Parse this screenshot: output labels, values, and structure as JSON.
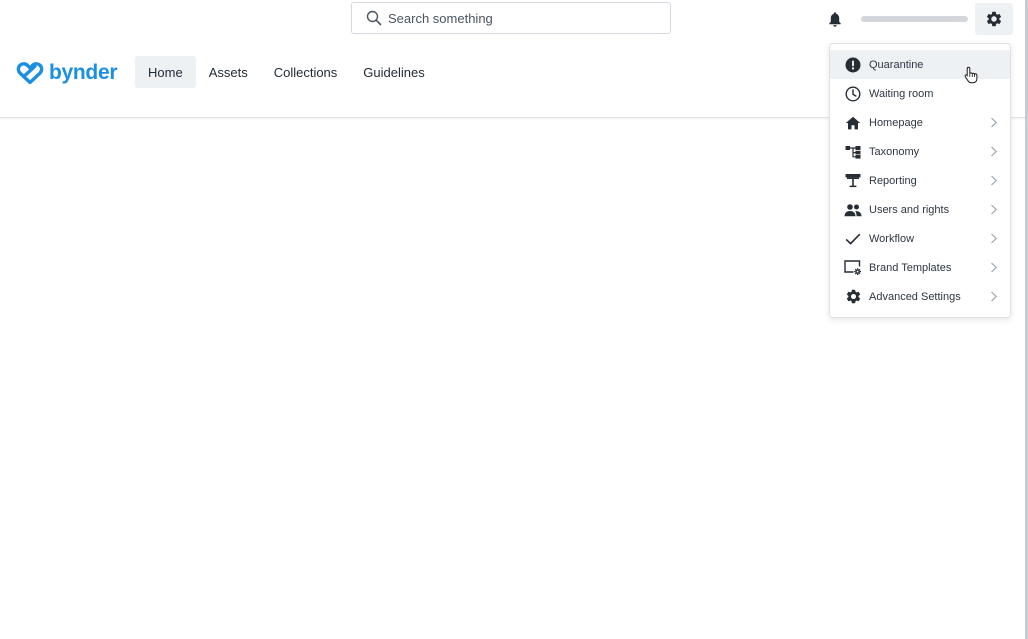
{
  "header": {
    "search": {
      "placeholder": "Search something",
      "icon": "search-icon"
    },
    "notifications_icon": "bell-icon",
    "settings_icon": "gear-icon"
  },
  "brand": {
    "name": "bynder",
    "color": "#1a8fe3"
  },
  "nav": {
    "items": [
      {
        "label": "Home",
        "active": true
      },
      {
        "label": "Assets",
        "active": false
      },
      {
        "label": "Collections",
        "active": false
      },
      {
        "label": "Guidelines",
        "active": false
      }
    ]
  },
  "settings_menu": {
    "items": [
      {
        "label": "Quarantine",
        "icon": "alert-circle-icon",
        "submenu": false,
        "hovered": true
      },
      {
        "label": "Waiting room",
        "icon": "clock-icon",
        "submenu": false
      },
      {
        "label": "Homepage",
        "icon": "home-icon",
        "submenu": true
      },
      {
        "label": "Taxonomy",
        "icon": "taxonomy-icon",
        "submenu": true
      },
      {
        "label": "Reporting",
        "icon": "presentation-icon",
        "submenu": true
      },
      {
        "label": "Users and rights",
        "icon": "users-icon",
        "submenu": true
      },
      {
        "label": "Workflow",
        "icon": "check-icon",
        "submenu": true
      },
      {
        "label": "Brand Templates",
        "icon": "brand-templates-icon",
        "submenu": true
      },
      {
        "label": "Advanced Settings",
        "icon": "gear-icon",
        "submenu": true
      }
    ]
  }
}
